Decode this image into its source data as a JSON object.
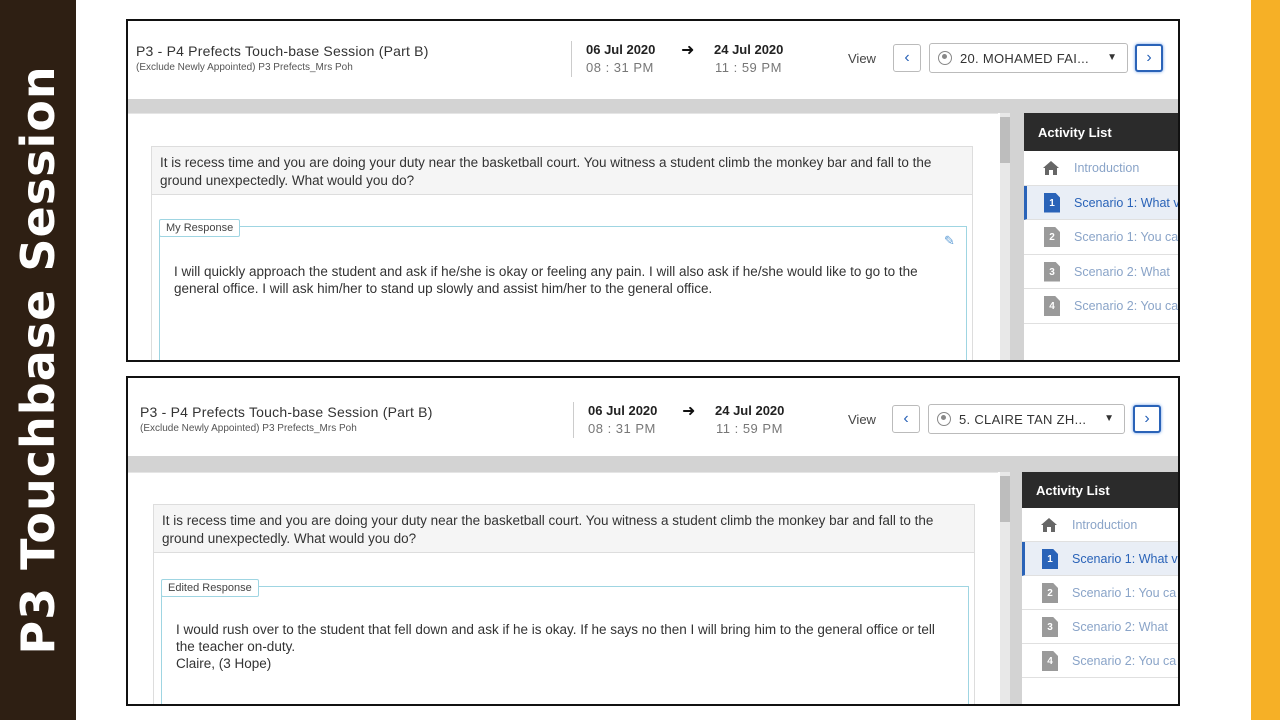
{
  "slide": {
    "banner_title": "P3 Touchbase Session"
  },
  "panels": [
    {
      "session_title": "P3 - P4 Prefects Touch-base Session (Part B)",
      "session_subtitle": "(Exclude Newly Appointed) P3 Prefects_Mrs Poh",
      "start_date": "06 Jul 2020",
      "start_time": "08 : 31 PM",
      "end_date": "24 Jul 2020",
      "end_time": "11 : 59 PM",
      "view_label": "View",
      "student_name": "20. MOHAMED FAI...",
      "question": "It is recess time and you are doing your duty near the basketball court. You witness a student climb the monkey bar and fall to the ground unexpectedly. What would you do?",
      "response_tag": "My Response",
      "response_text": "I will quickly approach the student and ask if he/she is okay or feeling any pain. I will also ask if he/she would like to go to the general office. I will ask him/her to stand up slowly and assist him/her to the general office.",
      "activity_header": "Activity List",
      "activities": [
        "Introduction",
        "Scenario 1: What v",
        "Scenario 1: You ca",
        "Scenario 2: What",
        "Scenario 2: You ca"
      ],
      "activity_numbers": [
        "",
        "1",
        "2",
        "3",
        "4"
      ]
    },
    {
      "session_title": "P3 - P4 Prefects Touch-base Session (Part B)",
      "session_subtitle": "(Exclude Newly Appointed) P3 Prefects_Mrs Poh",
      "start_date": "06 Jul 2020",
      "start_time": "08 : 31 PM",
      "end_date": "24 Jul 2020",
      "end_time": "11 : 59 PM",
      "view_label": "View",
      "student_name": "5. CLAIRE TAN ZH...",
      "question": "It is recess time and you are doing your duty near the basketball court. You witness a student climb the monkey bar and fall to the ground unexpectedly. What would you do?",
      "response_tag": "Edited Response",
      "response_text": "I would rush over to the student that fell down and ask if he is okay. If he says no then I will bring him to the general office or tell the teacher on-duty.\nClaire, (3 Hope)",
      "activity_header": "Activity List",
      "activities": [
        "Introduction",
        "Scenario 1: What v",
        "Scenario 1: You ca",
        "Scenario 2: What",
        "Scenario 2: You ca"
      ],
      "activity_numbers": [
        "",
        "1",
        "2",
        "3",
        "4"
      ]
    }
  ],
  "icons": {
    "prev": "chevron-left-icon",
    "next": "chevron-right-icon",
    "arrow": "arrow-right-icon",
    "user": "user-icon",
    "caret": "caret-down-icon",
    "edit": "pencil-icon",
    "home": "home-icon",
    "doc": "numbered-document-icon"
  },
  "colors": {
    "banner": "#2e1f13",
    "stripe": "#f6b026",
    "accent": "#2a63b8",
    "response_border": "#9fd5e2"
  }
}
